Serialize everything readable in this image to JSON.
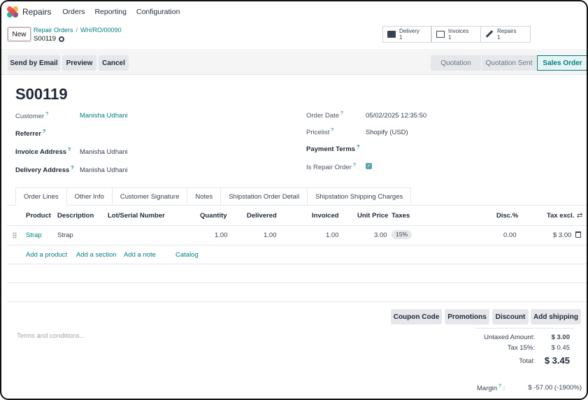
{
  "nav": {
    "app_name": "Repairs",
    "menu": [
      "Orders",
      "Reporting",
      "Configuration"
    ]
  },
  "control": {
    "new_label": "New",
    "breadcrumb_parent": "Repair Orders",
    "breadcrumb_current": "WH/RO/00090",
    "record_name": "S00119",
    "smart_buttons": [
      {
        "label": "Delivery",
        "count": "1",
        "icon": "truck-icon"
      },
      {
        "label": "Invoices",
        "count": "1",
        "icon": "invoice-icon"
      },
      {
        "label": "Repairs",
        "count": "1",
        "icon": "wrench-icon"
      }
    ]
  },
  "actions": {
    "send_email": "Send by Email",
    "preview": "Preview",
    "cancel": "Cancel",
    "statuses": [
      "Quotation",
      "Quotation Sent",
      "Sales Order"
    ],
    "active_status": "Sales Order"
  },
  "form": {
    "title": "S00119",
    "customer_label": "Customer",
    "customer_value": "Manisha Udhani",
    "referrer_label": "Referrer",
    "invoice_address_label": "Invoice Address",
    "invoice_address_value": "Manisha Udhani",
    "delivery_address_label": "Delivery Address",
    "delivery_address_value": "Manisha Udhani",
    "order_date_label": "Order Date",
    "order_date_value": "05/02/2025 12:35:50",
    "pricelist_label": "Pricelist",
    "pricelist_value": "Shopify (USD)",
    "payment_terms_label": "Payment Terms",
    "is_repair_label": "Is Repair Order",
    "help_mark": "?"
  },
  "tabs": [
    "Order Lines",
    "Other Info",
    "Customer Signature",
    "Notes",
    "Shipstation Order Detail",
    "Shipstation Shipping Charges"
  ],
  "table": {
    "headers": [
      "Product",
      "Description",
      "Lot/Serial Number",
      "Quantity",
      "Delivered",
      "Invoiced",
      "Unit Price",
      "Taxes",
      "Disc.%",
      "Tax excl."
    ],
    "row": {
      "product": "Strap",
      "description": "Strap",
      "quantity": "1.00",
      "delivered": "1.00",
      "invoiced": "1.00",
      "unit_price": "3.00",
      "taxes": "15%",
      "disc": "0.00",
      "tax_excl": "$ 3.00"
    },
    "add_product": "Add a product",
    "add_section": "Add a section",
    "add_note": "Add a note",
    "catalog": "Catalog"
  },
  "bottom": {
    "coupon": "Coupon Code",
    "promotions": "Promotions",
    "discount": "Discount",
    "add_shipping": "Add shipping",
    "terms_placeholder": "Terms and conditions...",
    "untaxed_label": "Untaxed Amount:",
    "untaxed_value": "$ 3.00",
    "tax_label": "Tax 15%:",
    "tax_value": "$ 0.45",
    "total_label": "Total:",
    "total_value": "$ 3.45",
    "margin_label": "Margin",
    "margin_colon": ":",
    "margin_value": "$ -57.00 (-1900%)"
  },
  "colors": {
    "accent": "#017e84"
  }
}
